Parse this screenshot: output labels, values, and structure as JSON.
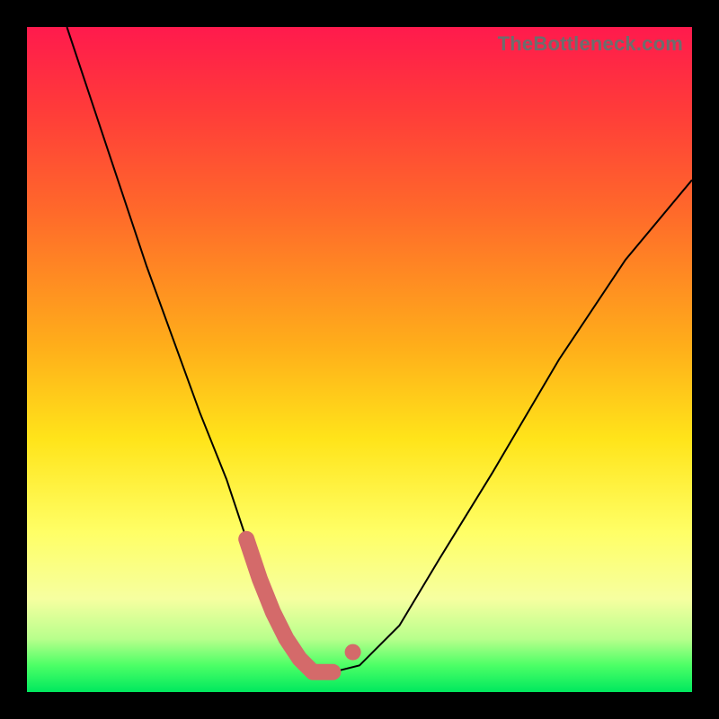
{
  "watermark": "TheBottleneck.com",
  "chart_data": {
    "type": "line",
    "title": "",
    "xlabel": "",
    "ylabel": "",
    "xlim": [
      0,
      100
    ],
    "ylim": [
      0,
      100
    ],
    "grid": false,
    "legend": false,
    "series": [
      {
        "name": "curve",
        "x": [
          6,
          10,
          14,
          18,
          22,
          26,
          30,
          33,
          35,
          37,
          39,
          41,
          43,
          46,
          50,
          56,
          62,
          70,
          80,
          90,
          100
        ],
        "y": [
          100,
          88,
          76,
          64,
          53,
          42,
          32,
          23,
          17,
          12,
          8,
          5,
          3,
          3,
          4,
          10,
          20,
          33,
          50,
          65,
          77
        ]
      }
    ],
    "highlight_band": {
      "note": "thick pink segment near curve minimum",
      "x": [
        33,
        35,
        37,
        39,
        41,
        43,
        46
      ],
      "y": [
        23,
        17,
        12,
        8,
        5,
        3,
        3
      ]
    },
    "marker": {
      "note": "isolated pink dot just above highlight band on right side",
      "x": 49,
      "y": 6
    },
    "background_gradient": {
      "top": "#ff1a4d",
      "bottom": "#00e85e"
    }
  }
}
